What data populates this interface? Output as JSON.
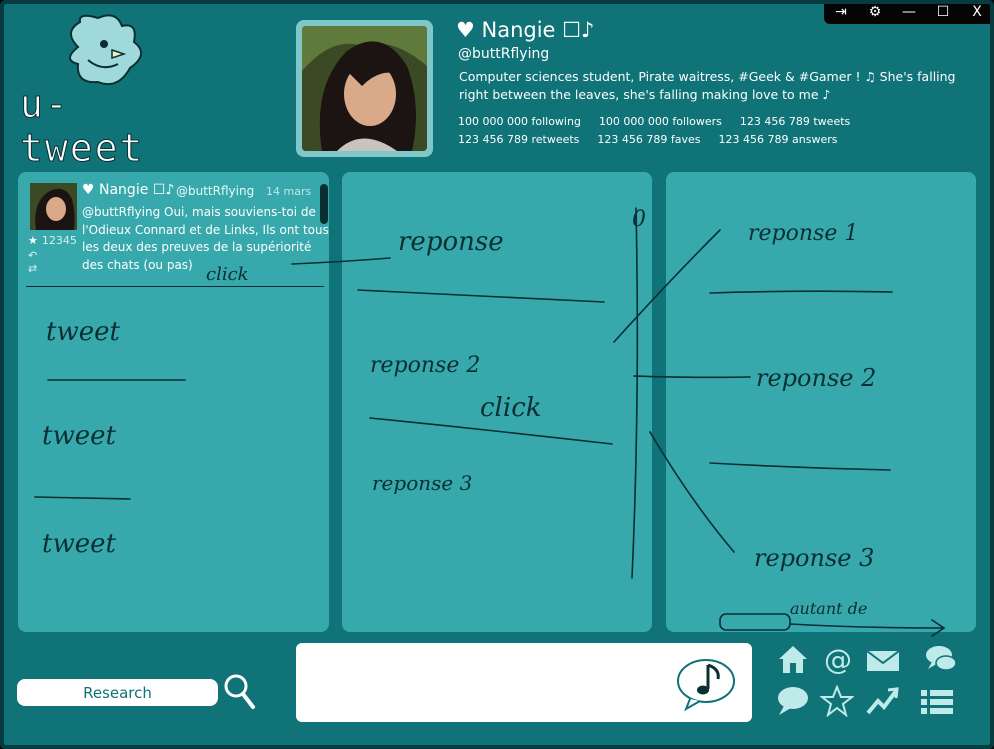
{
  "window": {
    "controls": [
      "⇥",
      "⚙",
      "—",
      "☐",
      "X"
    ]
  },
  "logo": {
    "text": "u-tweet"
  },
  "profile": {
    "name": "♥ Nangie ☐♪",
    "handle": "@buttRflying",
    "bio": "Computer sciences student, Pirate waitress, #Geek & #Gamer ! ♫ She's falling right between the leaves, she's falling making love to me ♪",
    "stats": [
      [
        "100 000 000 following",
        "100 000 000 followers",
        "123 456 789 tweets"
      ],
      [
        "123 456 789 retweets",
        "123 456 789 faves",
        "123 456 789 answers"
      ]
    ]
  },
  "tweet": {
    "name": "♥ Nangie ☐♪",
    "handle": "@buttRflying",
    "date": "14 mars",
    "text": "@buttRflying Oui, mais souviens-toi de l'Odieux Connard et de Links, Ils ont tous les deux des preuves de la supériorité des chats (ou pas)",
    "favs": "12345"
  },
  "sketch_labels": {
    "col1": [
      "click",
      "tweet",
      "tweet",
      "tweet"
    ],
    "col2": [
      "reponse",
      "reponse 2",
      "click",
      "reponse 3",
      "0"
    ],
    "col3": [
      "reponse 1",
      "reponse 2",
      "reponse 3",
      "autant de"
    ]
  },
  "bottom": {
    "search_label": "Research",
    "icons": [
      "home-icon",
      "at-icon",
      "mail-icon",
      "chat-bubbles-icon",
      "speech-icon",
      "star-icon",
      "trend-icon",
      "list-icon"
    ]
  },
  "colors": {
    "background": "#0f7378",
    "panel": "#37a9ac",
    "dark": "#0a2f33"
  }
}
